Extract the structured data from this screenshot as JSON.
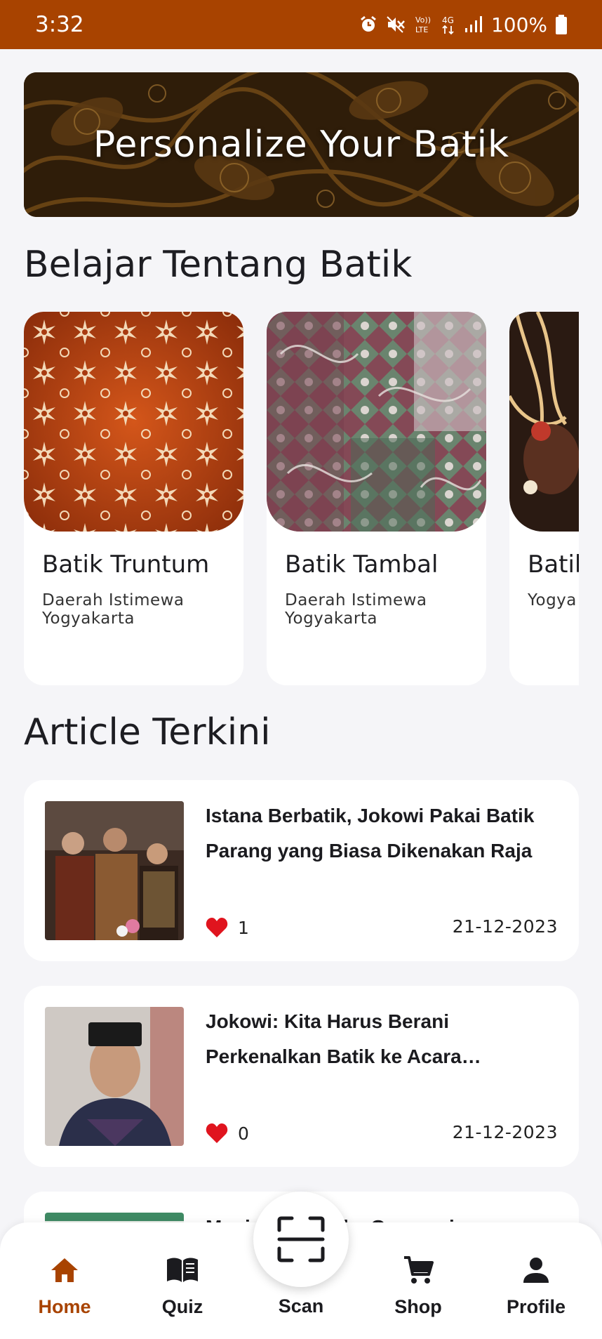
{
  "status_bar": {
    "time": "3:32",
    "battery": "100%",
    "icons": [
      "alarm-icon",
      "mute-icon",
      "volte-icon",
      "4g-icon",
      "signal-icon",
      "battery-icon"
    ]
  },
  "banner": {
    "title": "Personalize Your Batik"
  },
  "learn_section": {
    "title": "Belajar Tentang Batik",
    "cards": [
      {
        "title": "Batik Truntum",
        "region": "Daerah Istimewa Yogyakarta"
      },
      {
        "title": "Batik Tambal",
        "region": "Daerah Istimewa Yogyakarta"
      },
      {
        "title": "Batik",
        "region": "Yogya"
      }
    ]
  },
  "article_section": {
    "title": "Article Terkini",
    "articles": [
      {
        "title": "Istana Berbatik, Jokowi Pakai Batik Parang yang Biasa Dikenakan Raja",
        "likes": "1",
        "date": "21-12-2023"
      },
      {
        "title": "Jokowi: Kita Harus Berani Perkenalkan Batik ke Acara Internasional",
        "likes": "0",
        "date": "21-12-2023"
      },
      {
        "title": "Menjaga Batik ke Generasi Selanjutnya",
        "likes": "",
        "date": ""
      }
    ]
  },
  "bottom_nav": {
    "items": [
      {
        "label": "Home",
        "icon": "home-icon",
        "active": true
      },
      {
        "label": "Quiz",
        "icon": "book-icon",
        "active": false
      },
      {
        "label": "Scan",
        "icon": "scan-icon",
        "active": false
      },
      {
        "label": "Shop",
        "icon": "cart-icon",
        "active": false
      },
      {
        "label": "Profile",
        "icon": "person-icon",
        "active": false
      }
    ]
  },
  "colors": {
    "brand": "#a84300",
    "background": "#f5f5f8",
    "like": "#e0141e"
  }
}
